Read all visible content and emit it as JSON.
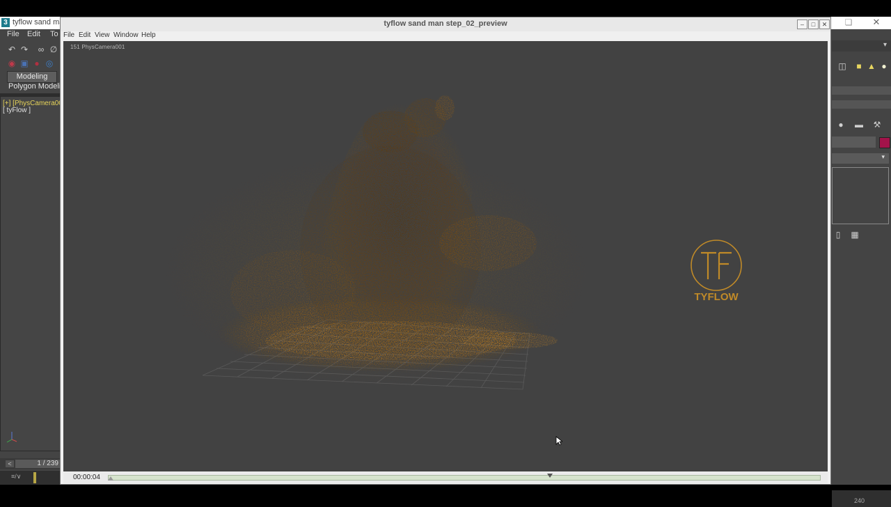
{
  "max_app": {
    "title": "tyflow sand ma",
    "menu": [
      "File",
      "Edit",
      "To"
    ],
    "ribbon_tab": "Modeling",
    "ribbon_label": "Polygon Modelir",
    "viewport_label_camera": "[+] [PhysCamera00",
    "viewport_label_object": "[ tyFlow ]",
    "frame_prev": "<",
    "frame_counter": "1 / 239",
    "track_icon": "≡/∨",
    "frame_end": "240",
    "colors": {
      "swatch": "#a3134a",
      "background": "#444444"
    },
    "icons": [
      "undo-icon",
      "redo-icon",
      "link-icon",
      "unlink-icon",
      "teapot-icon",
      "box-icon",
      "sphere-icon",
      "render-icon"
    ]
  },
  "preview": {
    "title": "tyflow sand man step_02_preview",
    "menu": [
      "File",
      "Edit",
      "View",
      "Window",
      "Help"
    ],
    "viewport_label": "151  PhysCamera001",
    "logo_text": "TYFLOW",
    "time": "00:00:04",
    "playback_progress": 0.62,
    "colors": {
      "sand": "#b07018",
      "viewport_bg": "#424242",
      "logo": "#c08a28",
      "track": "#d6e3cd"
    }
  }
}
